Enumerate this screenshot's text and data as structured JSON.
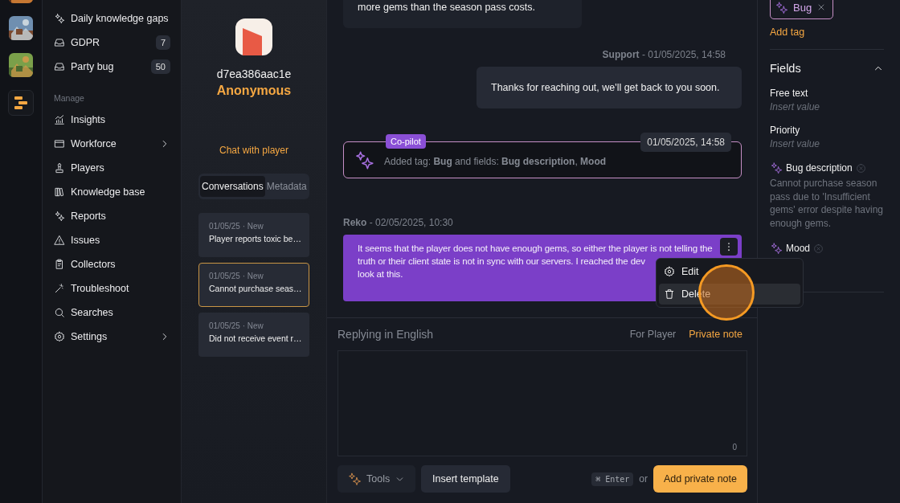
{
  "rail": {
    "items": [
      {
        "kind": "picture"
      },
      {
        "kind": "picture"
      },
      {
        "kind": "picture"
      },
      {
        "kind": "logo"
      }
    ]
  },
  "nav": {
    "items": [
      {
        "label": "Daily knowledge gaps"
      },
      {
        "label": "GDPR",
        "badge": "7"
      },
      {
        "label": "Party bug",
        "badge": "50"
      }
    ],
    "manage": {
      "heading": "Manage",
      "items": [
        {
          "label": "Insights",
          "expandable": false
        },
        {
          "label": "Workforce",
          "expandable": true
        },
        {
          "label": "Players",
          "expandable": false
        },
        {
          "label": "Knowledge base",
          "expandable": false
        },
        {
          "label": "Reports",
          "expandable": false
        },
        {
          "label": "Issues",
          "expandable": false
        },
        {
          "label": "Collectors",
          "expandable": false
        },
        {
          "label": "Troubleshoot",
          "expandable": false
        },
        {
          "label": "Searches",
          "expandable": false
        },
        {
          "label": "Settings",
          "expandable": true
        }
      ]
    }
  },
  "player": {
    "id": "d7ea386aac1e",
    "name": "Anonymous",
    "action": "Chat with player",
    "tabs": [
      {
        "label": "Conversations",
        "selected": true
      },
      {
        "label": "Metadata",
        "selected": false
      }
    ],
    "conversations": [
      {
        "meta": "01/05/25 · New",
        "title": "Player reports toxic be…",
        "selected": false
      },
      {
        "meta": "01/05/25 · New",
        "title": "Cannot purchase seas…",
        "selected": true
      },
      {
        "meta": "01/05/25 · New",
        "title": "Did not receive event r…",
        "selected": false
      }
    ]
  },
  "chat": {
    "messages": [
      {
        "kind": "incoming",
        "text": "more gems than the season pass costs."
      },
      {
        "kind": "outgoing",
        "meta": "**Support** - 01/05/2025, 14:58",
        "text": "Thanks for reaching out, we'll get back to you soon."
      },
      {
        "kind": "copilot",
        "badge": "Co-pilot",
        "time": "01/05/2025, 14:58",
        "text": "Added tag: **Bug** and fields: **Bug description**, **Mood**"
      },
      {
        "kind": "note",
        "meta": "**Reko** - 02/05/2025, 10:30",
        "lines": [
          "It seems that the player does not have enough gems, so either the player is not telling the",
          "truth or their client state is not in sync with our servers. I reached the dev",
          "look at this."
        ],
        "menu": [
          {
            "label": "Edit",
            "selected": false
          },
          {
            "label": "Delete",
            "selected": true
          }
        ]
      }
    ]
  },
  "composer": {
    "language": "Replying in English",
    "modes": [
      {
        "label": "For Player",
        "selected": false
      },
      {
        "label": "Private note",
        "selected": true
      }
    ],
    "counter": "0",
    "tools": "Tools",
    "template": "Insert template",
    "shortcut": "⌘ Enter",
    "or": "or",
    "submit": "Add private note"
  },
  "details": {
    "tags": [
      {
        "label": "Bug"
      }
    ],
    "add_tag": "Add tag",
    "fields_title": "Fields",
    "expanded": true,
    "fields": [
      {
        "kind": "manual",
        "label": "Free text",
        "placeholder": "Insert value"
      },
      {
        "kind": "manual",
        "label": "Priority",
        "placeholder": "Insert value"
      },
      {
        "kind": "ai",
        "label": "Bug description",
        "value": "Cannot purchase season pass due to 'Insufficient gems' error despite having enough gems."
      },
      {
        "kind": "ai",
        "label": "Mood"
      }
    ]
  }
}
